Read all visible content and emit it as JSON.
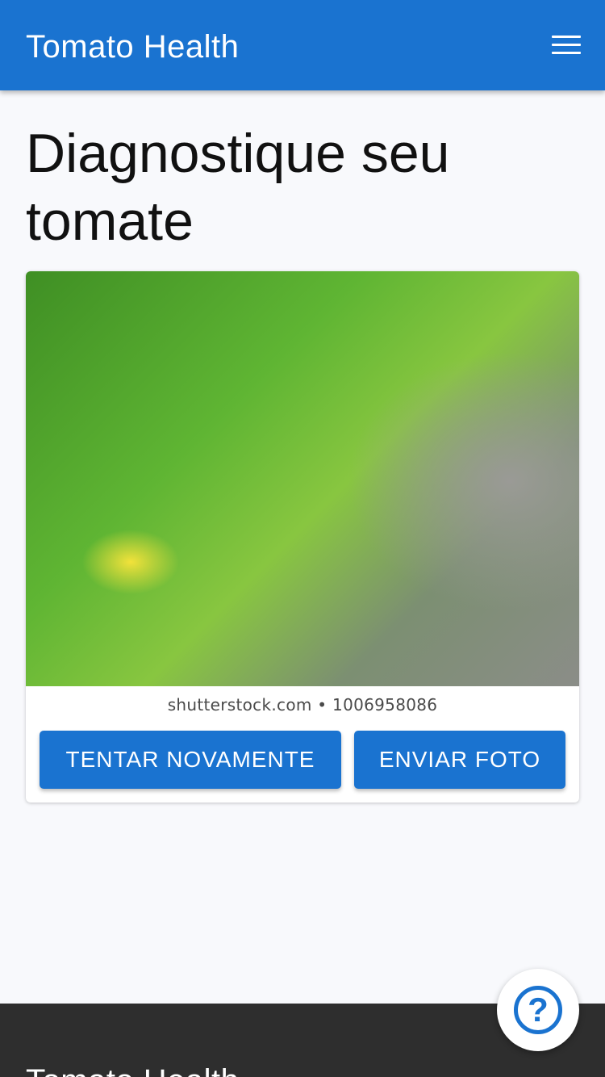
{
  "header": {
    "title": "Tomato Health",
    "menu_icon": "hamburger-menu-icon"
  },
  "main": {
    "title": "Diagnostique seu tomate",
    "card": {
      "image_alt": "Folha de tomate",
      "watermark": "shutterstock.com • 1006958086",
      "retry_label": "TENTAR NOVAMENTE",
      "send_label": "ENVIAR FOTO"
    }
  },
  "footer": {
    "title": "Tomato Health"
  },
  "help": {
    "icon": "help-question-icon",
    "glyph": "?"
  },
  "colors": {
    "primary": "#1a73d0",
    "footer_bg": "#2e2e2e",
    "page_bg": "#f8f9fc"
  }
}
